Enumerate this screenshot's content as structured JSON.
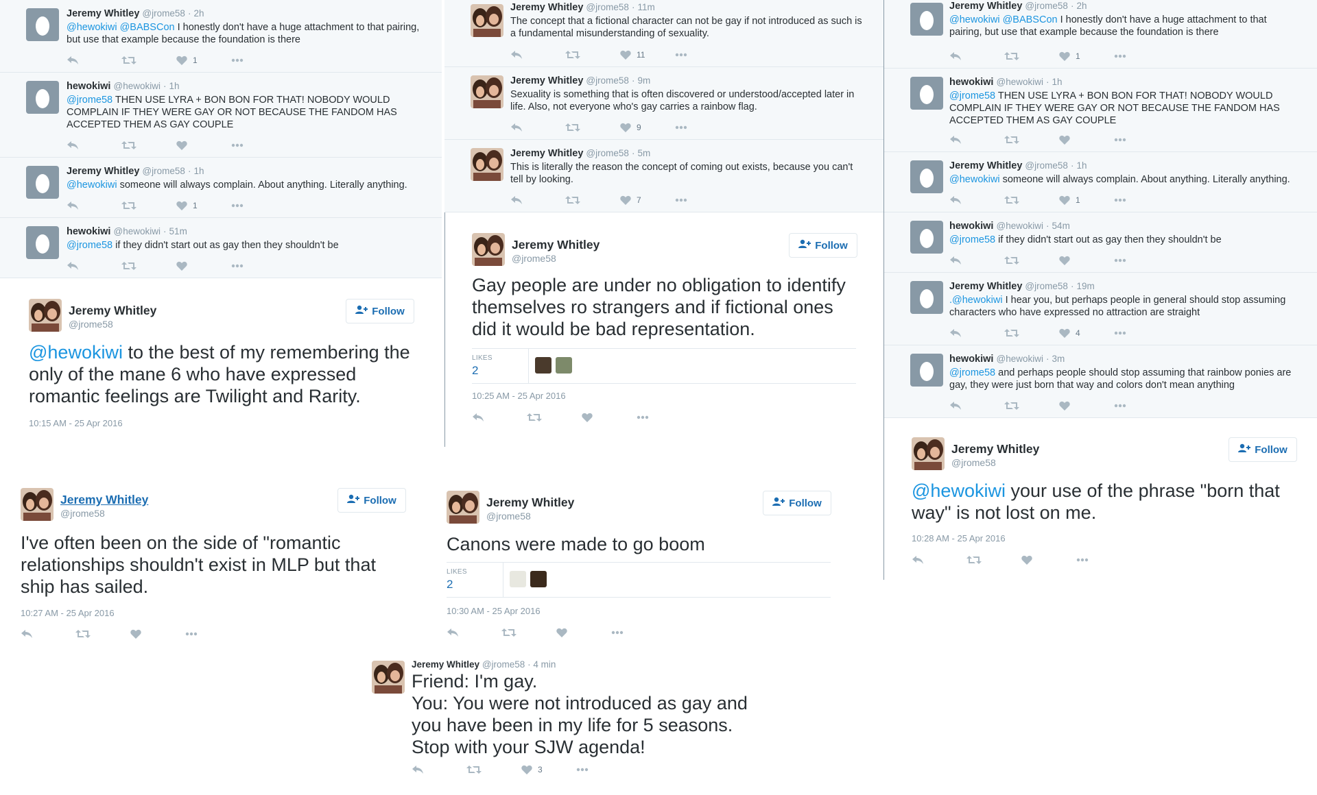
{
  "colors": {
    "accent": "#1b95e0",
    "text": "#292f33",
    "muted": "#8899a6",
    "reply_bg": "#f5f8fa"
  },
  "icons": {
    "reply": "reply-icon",
    "retweet": "retweet-icon",
    "like": "heart-icon",
    "more": "more-icon",
    "follow": "follow-person-icon"
  },
  "panel1": {
    "tweets": [
      {
        "name": "Jeremy Whitley",
        "handle": "@jrome58",
        "time": "2h",
        "mentions": "@hewokiwi @BABSCon",
        "text": " I honestly don't have a huge attachment to that pairing, but use that example because the foundation is there",
        "likes": "1"
      },
      {
        "name": "hewokiwi",
        "handle": "@hewokiwi",
        "time": "1h",
        "mentions": "@jrome58",
        "text": " THEN USE LYRA + BON BON FOR THAT! NOBODY WOULD COMPLAIN IF THEY WERE GAY OR NOT BECAUSE THE FANDOM HAS ACCEPTED THEM AS GAY COUPLE",
        "likes": ""
      },
      {
        "name": "Jeremy Whitley",
        "handle": "@jrome58",
        "time": "1h",
        "mentions": "@hewokiwi",
        "text": " someone will always complain. About anything. Literally anything.",
        "likes": "1"
      },
      {
        "name": "hewokiwi",
        "handle": "@hewokiwi",
        "time": "51m",
        "mentions": "@jrome58",
        "text": " if they didn't start out as gay then they shouldn't be",
        "likes": ""
      }
    ],
    "big": {
      "name": "Jeremy Whitley",
      "handle": "@jrome58",
      "follow": "Follow",
      "mention": "@hewokiwi",
      "text": " to the best of my remembering the only of the mane 6 who have expressed romantic feelings are Twilight and Rarity.",
      "time": "10:15 AM - 25 Apr 2016"
    }
  },
  "panel2": {
    "tweets": [
      {
        "name": "Jeremy Whitley",
        "handle": "@jrome58",
        "time": "11m",
        "text": "The concept that a fictional character can not be gay if not introduced as such is a fundamental misunderstanding of sexuality.",
        "likes": "11"
      },
      {
        "name": "Jeremy Whitley",
        "handle": "@jrome58",
        "time": "9m",
        "text": "Sexuality is something that is often discovered or understood/accepted later in life. Also, not everyone who's gay carries a rainbow flag.",
        "likes": "9"
      },
      {
        "name": "Jeremy Whitley",
        "handle": "@jrome58",
        "time": "5m",
        "text": "This is literally the reason the concept of coming out exists, because you can't tell by looking.",
        "likes": "7"
      }
    ],
    "big": {
      "name": "Jeremy Whitley",
      "handle": "@jrome58",
      "follow": "Follow",
      "text": "Gay people are under no obligation to identify themselves ro strangers and if fictional ones did it would be bad representation.",
      "likes_label": "LIKES",
      "likes_count": "2",
      "time": "10:25 AM - 25 Apr 2016"
    }
  },
  "panel3": {
    "tweets": [
      {
        "name": "Jeremy Whitley",
        "handle": "@jrome58",
        "time": "2h",
        "mentions": "@hewokiwi @BABSCon",
        "text": " I honestly don't have a huge attachment to that pairing, but use that example because the foundation is there",
        "likes": "1"
      },
      {
        "name": "hewokiwi",
        "handle": "@hewokiwi",
        "time": "1h",
        "mentions": "@jrome58",
        "text": " THEN USE LYRA + BON BON FOR THAT! NOBODY WOULD COMPLAIN IF THEY WERE GAY OR NOT BECAUSE THE FANDOM HAS ACCEPTED THEM AS GAY COUPLE",
        "likes": ""
      },
      {
        "name": "Jeremy Whitley",
        "handle": "@jrome58",
        "time": "1h",
        "mentions": "@hewokiwi",
        "text": " someone will always complain. About anything. Literally anything.",
        "likes": "1"
      },
      {
        "name": "hewokiwi",
        "handle": "@hewokiwi",
        "time": "54m",
        "mentions": "@jrome58",
        "text": " if they didn't start out as gay then they shouldn't be",
        "likes": ""
      },
      {
        "name": "Jeremy Whitley",
        "handle": "@jrome58",
        "time": "19m",
        "mentions": ".@hewokiwi",
        "text": " I hear you, but perhaps people in general should stop assuming characters who have expressed no attraction are straight",
        "likes": "4"
      },
      {
        "name": "hewokiwi",
        "handle": "@hewokiwi",
        "time": "3m",
        "mentions": "@jrome58",
        "text": " and perhaps people should stop assuming that rainbow ponies are gay, they were just born that way and colors don't mean anything",
        "likes": ""
      }
    ],
    "big": {
      "name": "Jeremy Whitley",
      "handle": "@jrome58",
      "follow": "Follow",
      "mention": "@hewokiwi",
      "text": " your use of the phrase \"born that way\" is not lost on me.",
      "time": "10:28 AM - 25 Apr 2016"
    }
  },
  "panel4": {
    "name": "Jeremy Whitley",
    "handle": "@jrome58",
    "follow": "Follow",
    "text": "I've often been on the side of \"romantic relationships shouldn't exist in MLP but that ship has sailed.",
    "time": "10:27 AM - 25 Apr 2016"
  },
  "panel5": {
    "name": "Jeremy Whitley",
    "handle": "@jrome58",
    "follow": "Follow",
    "text": "Canons were made to go boom",
    "likes_label": "LIKES",
    "likes_count": "2",
    "time": "10:30 AM - 25 Apr 2016"
  },
  "panel6": {
    "name": "Jeremy Whitley",
    "handle": "@jrome58",
    "time": "4 min",
    "text": "Friend: I'm gay.\nYou: You were not introduced as gay and you have been in my life for 5 seasons.\nStop with your SJW agenda!",
    "likes": "3"
  }
}
